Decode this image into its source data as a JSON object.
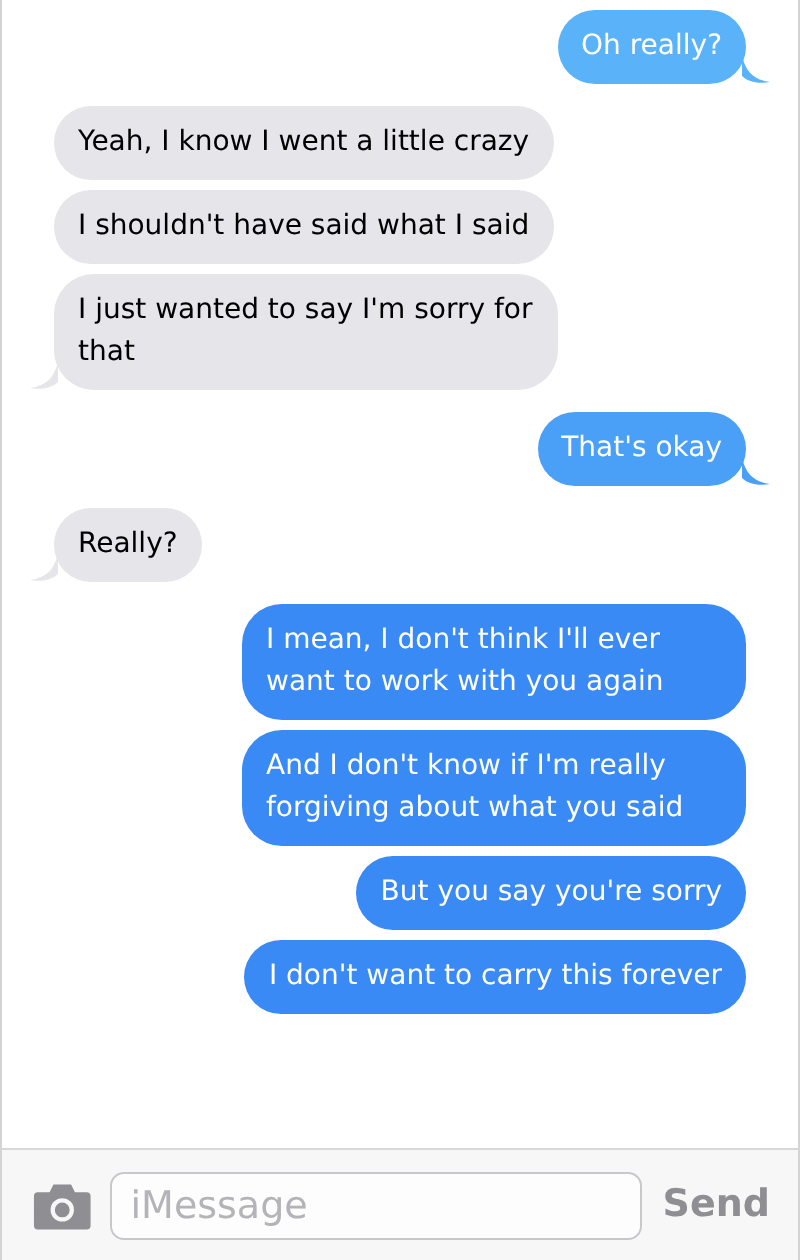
{
  "messages": [
    {
      "kind": "sent",
      "text": "Oh really?",
      "color": "#5ab3f8",
      "tail": true
    },
    {
      "kind": "received",
      "text": "Yeah, I know I went a little crazy",
      "tail": false
    },
    {
      "kind": "received",
      "text": "I shouldn't have said what I said",
      "tail": false
    },
    {
      "kind": "received",
      "text": "I just wanted to say I'm sorry for that",
      "tail": true
    },
    {
      "kind": "sent",
      "text": "That's okay",
      "color": "#4a9ff7",
      "tail": true
    },
    {
      "kind": "received",
      "text": "Really?",
      "tail": true
    },
    {
      "kind": "sent",
      "text": "I mean, I don't think I'll ever want to work with you again",
      "color": "#3a8af6",
      "tail": false
    },
    {
      "kind": "sent",
      "text": "And I don't know if I'm really forgiving about what you said",
      "color": "#3a8af6",
      "tail": false
    },
    {
      "kind": "sent",
      "text": "But you say you're sorry",
      "color": "#3a8af6",
      "tail": false
    },
    {
      "kind": "sent",
      "text": "I don't want to carry this forever",
      "color": "#3a8af6",
      "tail": false
    }
  ],
  "composer": {
    "placeholder": "iMessage",
    "send": "Send"
  }
}
